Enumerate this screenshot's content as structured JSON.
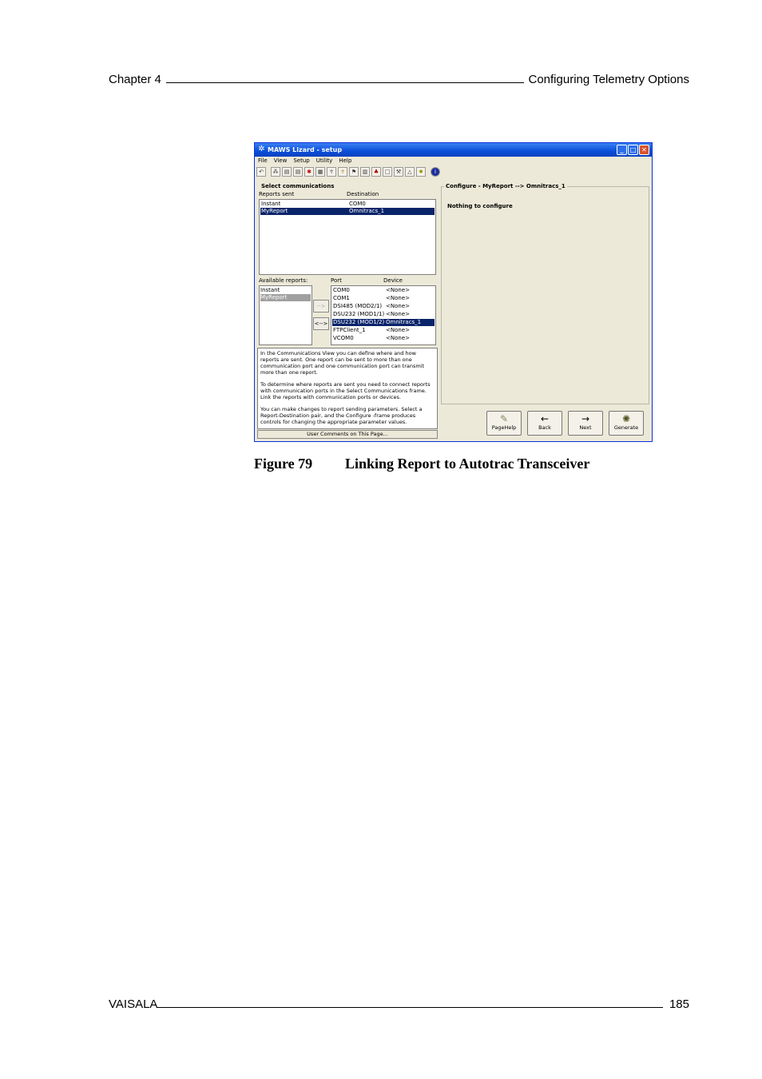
{
  "page_header": {
    "chapter": "Chapter 4",
    "section_title": "Configuring Telemetry Options"
  },
  "page_footer": {
    "company": "VAISALA",
    "page_number": "185"
  },
  "window": {
    "title": "MAWS Lizard - setup",
    "menu": [
      "File",
      "View",
      "Setup",
      "Utility",
      "Help"
    ],
    "toolbar_icons": [
      "undo-icon",
      "network-icon",
      "dev-icon",
      "dev-icon",
      "color-icon",
      "save-icon",
      "person-icon",
      "person-icon",
      "flag-icon",
      "grid-icon",
      "people-icon",
      "page-icon",
      "wrench-icon",
      "bell-icon",
      "gear-icon",
      "info-icon"
    ],
    "select_communications": {
      "group_title": "Select communications",
      "col_reports_sent": "Reports sent",
      "col_destination": "Destination",
      "rows": [
        {
          "report": "Instant",
          "destination": "COM0",
          "selected": false
        },
        {
          "report": "MyReport",
          "destination": "Omnitracs_1",
          "selected": true
        }
      ]
    },
    "available_reports": {
      "label": "Available reports:",
      "items": [
        {
          "name": "Instant",
          "state": "normal"
        },
        {
          "name": "MyReport",
          "state": "used"
        }
      ]
    },
    "ports": {
      "col_port": "Port",
      "col_device": "Device",
      "rows": [
        {
          "port": "COM0",
          "device": "<None>",
          "selected": false
        },
        {
          "port": "COM1",
          "device": "<None>",
          "selected": false
        },
        {
          "port": "DSI485 (MOD2/1)",
          "device": "<None>",
          "selected": false
        },
        {
          "port": "DSU232 (MOD1/1)",
          "device": "<None>",
          "selected": false
        },
        {
          "port": "DSU232 (MOD1/2)",
          "device": "Omnitracs_1",
          "selected": true
        },
        {
          "port": "FTPClient_1",
          "device": "<None>",
          "selected": false
        },
        {
          "port": "VCOM0",
          "device": "<None>",
          "selected": false
        }
      ]
    },
    "link_buttons": {
      "link": "-->",
      "unlink": "<-->"
    },
    "help_paragraphs": [
      "In the Communications View you can define where and how reports are sent. One report can be sent to more than one communication port and one communication port can transmit more than one report.",
      "To determine where reports are sent you need to connect reports with communication ports in the Select Communications frame. Link the reports with communication ports or devices.",
      "You can make changes to report sending parameters. Select a Report-Destination pair, and the Configure -frame produces controls for changing the appropriate parameter values."
    ],
    "user_comments": "User Comments on This Page...",
    "configure": {
      "title": "Configure - MyReport --> Omnitracs_1",
      "message": "Nothing to configure"
    },
    "nav_buttons": [
      {
        "label": "PageHelp",
        "icon": "help-icon"
      },
      {
        "label": "Back",
        "icon": "arrow-left-icon"
      },
      {
        "label": "Next",
        "icon": "arrow-right-icon"
      },
      {
        "label": "Generate",
        "icon": "generate-icon"
      }
    ]
  },
  "caption": {
    "number": "Figure 79",
    "text": "Linking Report to Autotrac Transceiver"
  }
}
